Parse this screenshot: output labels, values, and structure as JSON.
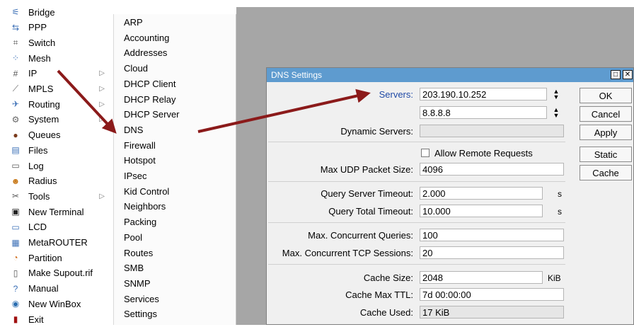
{
  "sidebar": {
    "items": [
      {
        "label": "Bridge",
        "icon": "bridge-icon"
      },
      {
        "label": "PPP",
        "icon": "ppp-icon"
      },
      {
        "label": "Switch",
        "icon": "switch-icon"
      },
      {
        "label": "Mesh",
        "icon": "mesh-icon"
      },
      {
        "label": "IP",
        "icon": "ip-icon",
        "submenu": "▷"
      },
      {
        "label": "MPLS",
        "icon": "mpls-icon",
        "submenu": "▷"
      },
      {
        "label": "Routing",
        "icon": "routing-icon",
        "submenu": "▷"
      },
      {
        "label": "System",
        "icon": "system-icon",
        "submenu": "▷"
      },
      {
        "label": "Queues",
        "icon": "queues-icon"
      },
      {
        "label": "Files",
        "icon": "files-icon"
      },
      {
        "label": "Log",
        "icon": "log-icon"
      },
      {
        "label": "Radius",
        "icon": "radius-icon"
      },
      {
        "label": "Tools",
        "icon": "tools-icon",
        "submenu": "▷"
      },
      {
        "label": "New Terminal",
        "icon": "terminal-icon"
      },
      {
        "label": "LCD",
        "icon": "lcd-icon"
      },
      {
        "label": "MetaROUTER",
        "icon": "metarouter-icon"
      },
      {
        "label": "Partition",
        "icon": "partition-icon"
      },
      {
        "label": "Make Supout.rif",
        "icon": "supout-icon"
      },
      {
        "label": "Manual",
        "icon": "manual-icon"
      },
      {
        "label": "New WinBox",
        "icon": "winbox-icon"
      },
      {
        "label": "Exit",
        "icon": "exit-icon"
      }
    ]
  },
  "submenu": {
    "items": [
      "ARP",
      "Accounting",
      "Addresses",
      "Cloud",
      "DHCP Client",
      "DHCP Relay",
      "DHCP Server",
      "DNS",
      "Firewall",
      "Hotspot",
      "IPsec",
      "Kid Control",
      "Neighbors",
      "Packing",
      "Pool",
      "Routes",
      "SMB",
      "SNMP",
      "Services",
      "Settings"
    ]
  },
  "dns_window": {
    "title": "DNS Settings",
    "servers_label": "Servers:",
    "server1": "203.190.10.252",
    "server2": "8.8.8.8",
    "dynamic_servers_label": "Dynamic Servers:",
    "dynamic_servers_value": "",
    "allow_remote_label": "Allow Remote Requests",
    "max_udp_label": "Max UDP Packet Size:",
    "max_udp_value": "4096",
    "query_server_timeout_label": "Query Server Timeout:",
    "query_server_timeout_value": "2.000",
    "query_total_timeout_label": "Query Total Timeout:",
    "query_total_timeout_value": "10.000",
    "max_concurrent_queries_label": "Max. Concurrent Queries:",
    "max_concurrent_queries_value": "100",
    "max_tcp_label": "Max. Concurrent TCP Sessions:",
    "max_tcp_value": "20",
    "cache_size_label": "Cache Size:",
    "cache_size_value": "2048",
    "cache_size_unit": "KiB",
    "cache_ttl_label": "Cache Max TTL:",
    "cache_ttl_value": "7d 00:00:00",
    "cache_used_label": "Cache Used:",
    "cache_used_value": "17 KiB",
    "seconds_unit": "s",
    "buttons": {
      "ok": "OK",
      "cancel": "Cancel",
      "apply": "Apply",
      "static": "Static",
      "cache": "Cache"
    },
    "window_buttons": {
      "restore": "□",
      "close": "✕"
    }
  },
  "colors": {
    "title_bar": "#5e9bcf",
    "arrow": "#8b1a1a",
    "desktop": "#a6a6a6"
  }
}
